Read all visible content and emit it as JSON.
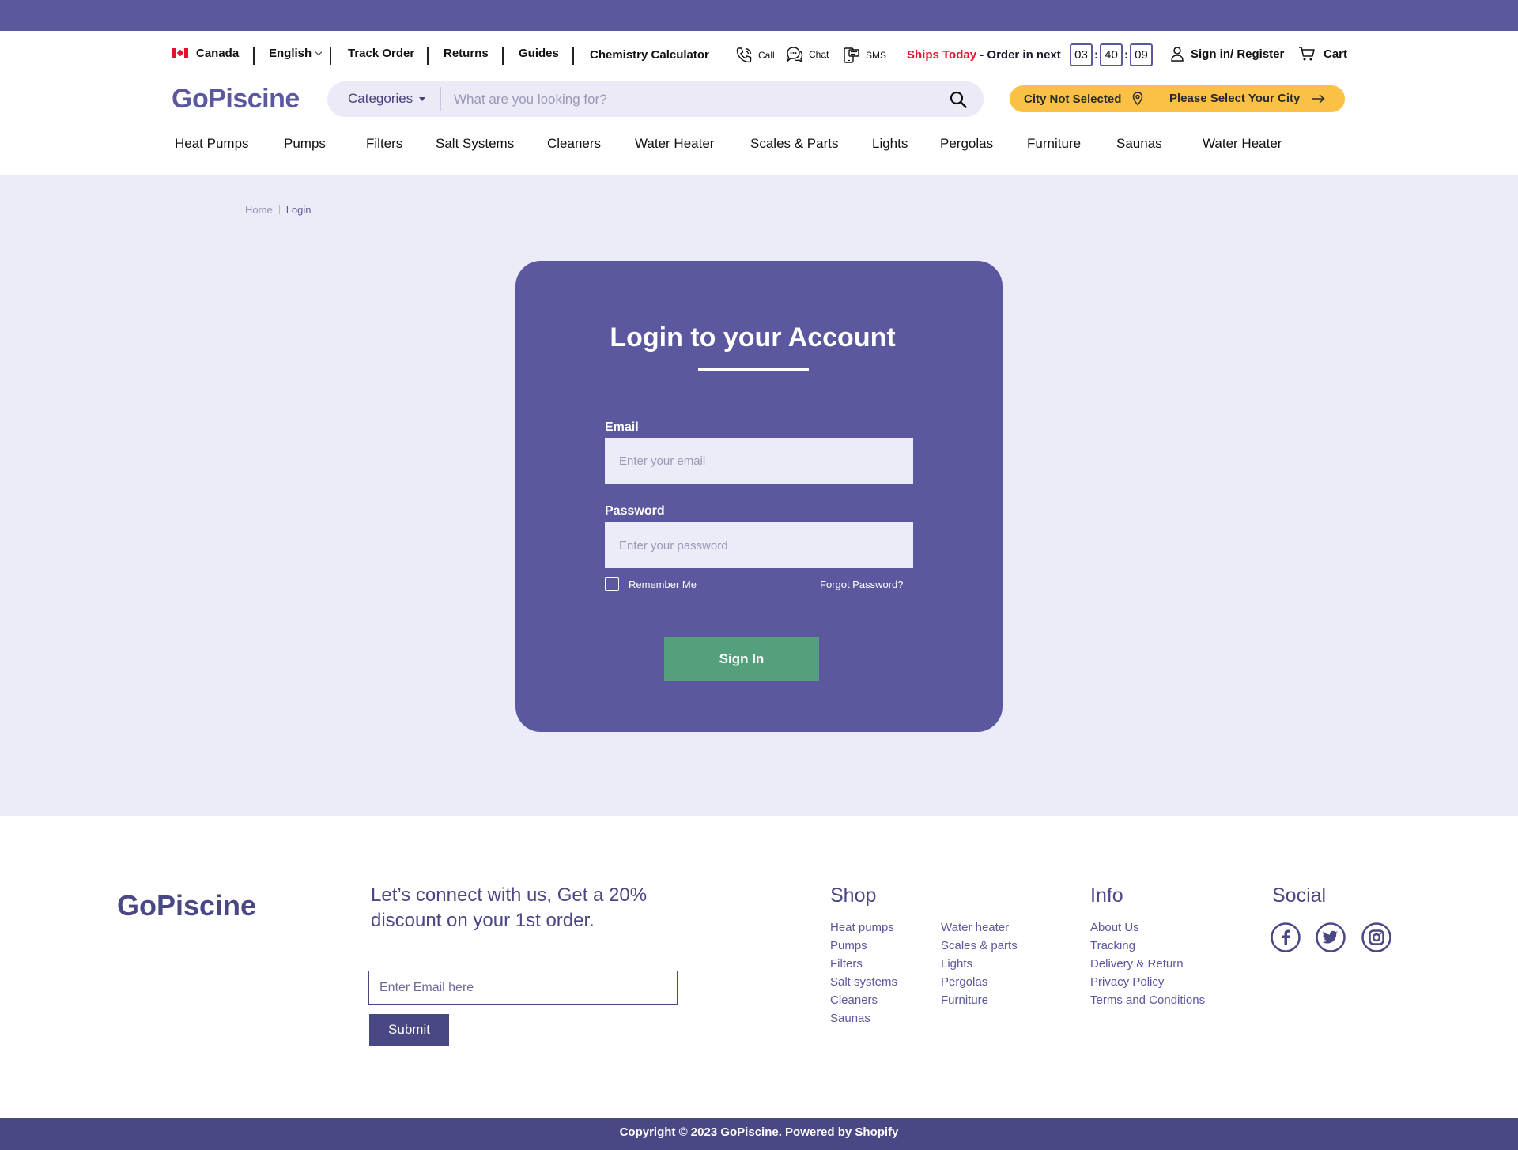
{
  "util": {
    "country": "Canada",
    "language": "English",
    "links": [
      "Track Order",
      "Returns",
      "Guides",
      "Chemistry Calculator"
    ],
    "call": "Call",
    "chat": "Chat",
    "sms": "SMS",
    "ships_today": "Ships Today",
    "order_next": " - Order in next",
    "timer": [
      "03",
      "40",
      "09"
    ],
    "signin": "Sign in/ Register",
    "cart": "Cart"
  },
  "header": {
    "logo": "GoPiscine",
    "categories": "Categories",
    "search_placeholder": "What are you looking for?",
    "city_status": "City Not Selected",
    "city_cta": "Please Select Your City"
  },
  "nav": [
    "Heat Pumps",
    "Pumps",
    "Filters",
    "Salt Systems",
    "Cleaners",
    "Water Heater",
    "Scales & Parts",
    "Lights",
    "Pergolas",
    "Furniture",
    "Saunas",
    "Water Heater"
  ],
  "breadcrumb": {
    "home": "Home",
    "current": "Login"
  },
  "login": {
    "title": "Login to your Account",
    "email_label": "Email",
    "email_placeholder": "Enter your email",
    "password_label": "Password",
    "password_placeholder": "Enter your password",
    "remember": "Remember Me",
    "forgot": "Forgot Password?",
    "submit": "Sign In"
  },
  "footer": {
    "logo": "GoPiscine",
    "connect": "Let’s connect with us, Get a 20% discount on your 1st order.",
    "email_placeholder": "Enter Email here",
    "submit": "Submit",
    "shop_title": "Shop",
    "shop_col1": [
      "Heat pumps",
      "Pumps",
      "Filters",
      "Salt systems",
      "Cleaners",
      "Saunas"
    ],
    "shop_col2": [
      "Water heater",
      "Scales & parts",
      "Lights",
      "Pergolas",
      "Furniture"
    ],
    "info_title": "Info",
    "info": [
      "About Us",
      "Tracking",
      "Delivery & Return",
      "Privacy Policy",
      "Terms and Conditions"
    ],
    "social_title": "Social",
    "social_icons": [
      "facebook-icon",
      "twitter-icon",
      "instagram-icon"
    ],
    "copyright": "Copyright © 2023 GoPiscine. Powered by Shopify"
  },
  "colors": {
    "brand": "#5b58a0",
    "brand_dark": "#4a4785",
    "accent_yellow": "#fbc146",
    "signin_green": "#55a07c",
    "alert_red": "#e8112d",
    "page_bg": "#ecebf8"
  }
}
